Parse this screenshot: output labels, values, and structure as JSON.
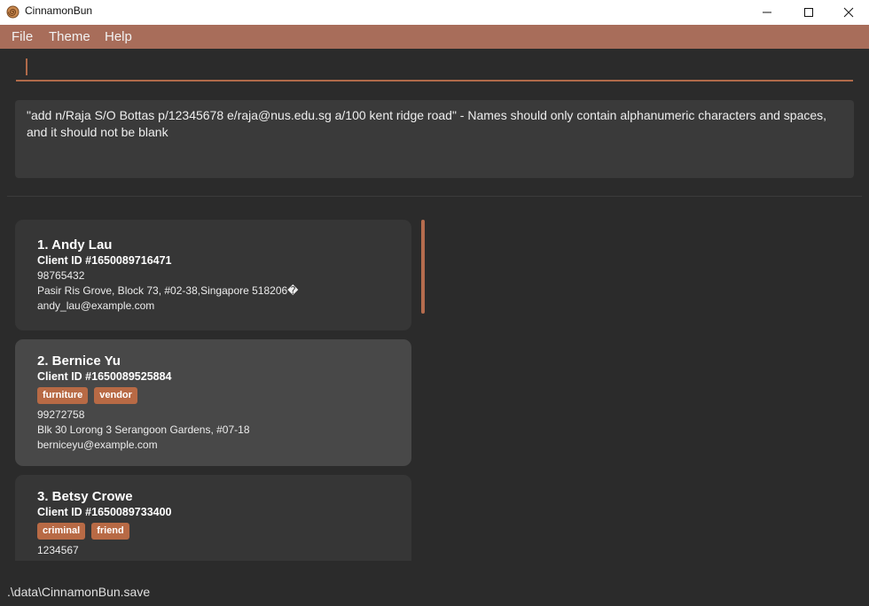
{
  "window": {
    "title": "CinnamonBun",
    "icon": "cinnamon-bun-icon"
  },
  "menu": {
    "file": "File",
    "theme": "Theme",
    "help": "Help"
  },
  "command": {
    "value": "",
    "placeholder": ""
  },
  "result": {
    "text": "\"add n/Raja S/O Bottas p/12345678 e/raja@nus.edu.sg a/100 kent ridge road\" - Names should only contain alphanumeric characters and spaces, and it should not be blank"
  },
  "persons": [
    {
      "index_name": "1.  Andy Lau",
      "client_id": "Client ID #1650089716471",
      "tags": [],
      "phone": "98765432",
      "address": "Pasir Ris Grove, Block 73, #02-38,Singapore 518206�",
      "email": "andy_lau@example.com"
    },
    {
      "index_name": "2.  Bernice Yu",
      "client_id": "Client ID #1650089525884",
      "tags": [
        "furniture",
        "vendor"
      ],
      "phone": "99272758",
      "address": "Blk 30 Lorong 3 Serangoon Gardens, #07-18",
      "email": "berniceyu@example.com"
    },
    {
      "index_name": "3.  Betsy Crowe",
      "client_id": "Client ID #1650089733400",
      "tags": [
        "criminal",
        "friend"
      ],
      "phone": "1234567"
    }
  ],
  "status": {
    "save_path": ".\\data\\CinnamonBun.save"
  },
  "colors": {
    "accent": "#b06a4a",
    "menubar": "#a86d5a",
    "background": "#2b2b2b",
    "tag": "#b86a45"
  }
}
